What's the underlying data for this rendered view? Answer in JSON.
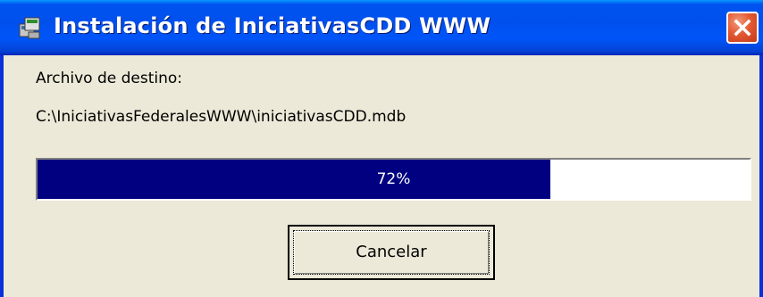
{
  "window": {
    "title": "Instalación de IniciativasCDD WWW",
    "icon": "installer-icon",
    "close_icon": "close-icon"
  },
  "content": {
    "destination_label": "Archivo de destino:",
    "destination_path": "C:\\IniciativasFederalesWWW\\iniciativasCDD.mdb"
  },
  "progress": {
    "percent": 72,
    "percent_label": "72%",
    "fill_color": "#000080"
  },
  "buttons": {
    "cancel_label": "Cancelar"
  },
  "colors": {
    "titlebar": "#0053ee",
    "close": "#e35a32",
    "face": "#ece9d8"
  }
}
